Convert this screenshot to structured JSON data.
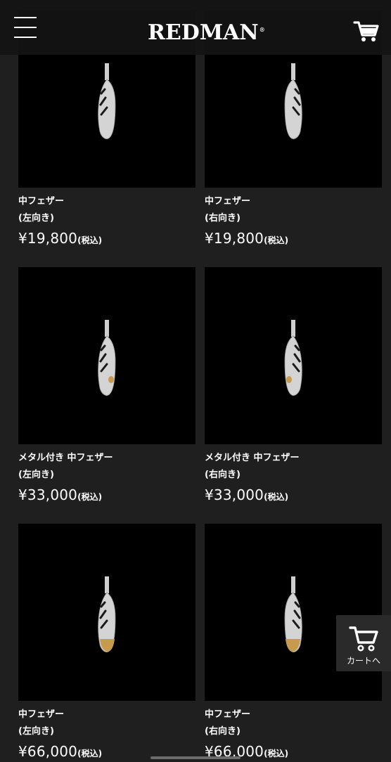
{
  "header": {
    "logo_text": "REDMAN",
    "logo_mark": "®",
    "menu_icon": "hamburger-menu-icon",
    "cart_icon": "cart-icon"
  },
  "products": [
    {
      "name": "中フェザー",
      "direction": "(左向き)",
      "price": "¥19,800",
      "tax": "(税込)",
      "facing": "left",
      "metal": "none"
    },
    {
      "name": "中フェザー",
      "direction": "(右向き)",
      "price": "¥19,800",
      "tax": "(税込)",
      "facing": "right",
      "metal": "none"
    },
    {
      "name": "メタル付き 中フェザー",
      "direction": "(左向き)",
      "price": "¥33,000",
      "tax": "(税込)",
      "facing": "left",
      "metal": "small"
    },
    {
      "name": "メタル付き 中フェザー",
      "direction": "(右向き)",
      "price": "¥33,000",
      "tax": "(税込)",
      "facing": "right",
      "metal": "small"
    },
    {
      "name": "中フェザー",
      "direction": "(左向き)",
      "price": "¥66,000",
      "tax": "(税込)",
      "facing": "left",
      "metal": "tip"
    },
    {
      "name": "中フェザー",
      "direction": "(右向き)",
      "price": "¥66,000",
      "tax": "(税込)",
      "facing": "right",
      "metal": "tip"
    }
  ],
  "cart_float": {
    "label": "カートへ",
    "icon": "cart-icon"
  },
  "colors": {
    "page_bg": "#1f1f1f",
    "thumb_bg": "#000000",
    "silver": "#d9d9d9",
    "gold": "#c89a4e"
  }
}
